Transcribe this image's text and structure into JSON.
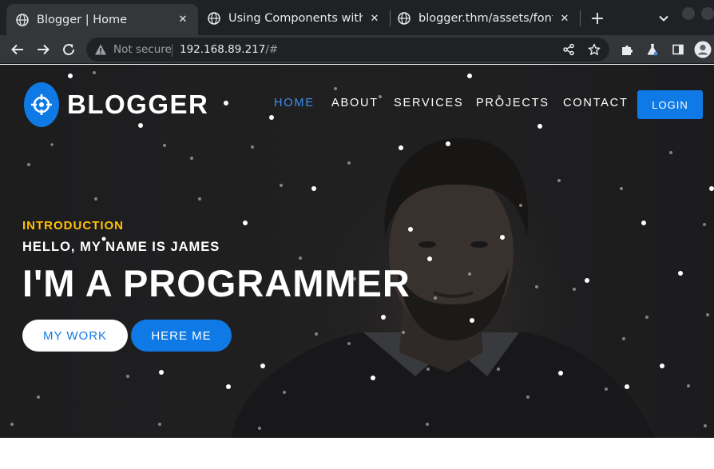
{
  "browser": {
    "tabs": [
      {
        "title": "Blogger | Home",
        "active": true
      },
      {
        "title": "Using Components with K",
        "active": false
      },
      {
        "title": "blogger.thm/assets/fonts/",
        "active": false
      }
    ],
    "new_tab_label": "+",
    "close_glyph": "✕",
    "address_bar": {
      "security_label": "Not secure",
      "url_host": "192.168.89.217",
      "url_path": "/#"
    }
  },
  "site": {
    "brand": "BLOGGER",
    "nav": {
      "home": "HOME",
      "about": "ABOUT",
      "services": "SERVICES",
      "projects": "PROJECTS",
      "contact": "CONTACT"
    },
    "login_label": "LOGIN",
    "hero": {
      "eyebrow": "INTRODUCTION",
      "greeting": "HELLO, MY NAME IS JAMES",
      "headline": "I'M A PROGRAMMER",
      "primary_button": "MY WORK",
      "secondary_button": "HERE ME"
    }
  },
  "colors": {
    "accent": "#0f7ae5",
    "eyebrow": "#ffc107",
    "nav_active": "#3f8ef0",
    "browser_frame": "#202124",
    "browser_toolbar": "#35363a"
  },
  "icons": [
    "globe-icon",
    "close-icon",
    "plus-icon",
    "chevron-down-icon",
    "back-arrow-icon",
    "forward-arrow-icon",
    "reload-icon",
    "warning-icon",
    "share-icon",
    "star-icon",
    "puzzle-icon",
    "flask-icon",
    "sidebar-icon",
    "profile-icon",
    "crosshair-logo-icon"
  ]
}
